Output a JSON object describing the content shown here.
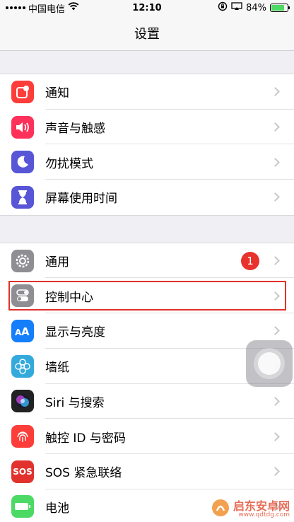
{
  "status_bar": {
    "carrier": "中国电信",
    "time": "12:10",
    "battery_percent": "84%",
    "battery_level": 0.84
  },
  "nav": {
    "title": "设置"
  },
  "groups": [
    {
      "items": [
        {
          "label": "通知",
          "icon": "notifications-icon",
          "color": "#fc3d39"
        },
        {
          "label": "声音与触感",
          "icon": "sound-icon",
          "color": "#fd3159"
        },
        {
          "label": "勿扰模式",
          "icon": "moon-icon",
          "color": "#5856d6"
        },
        {
          "label": "屏幕使用时间",
          "icon": "hourglass-icon",
          "color": "#5856d6"
        }
      ]
    },
    {
      "items": [
        {
          "label": "通用",
          "icon": "gear-icon",
          "color": "#8e8e93",
          "badge": "1"
        },
        {
          "label": "控制中心",
          "icon": "toggles-icon",
          "color": "#8e8e93"
        },
        {
          "label": "显示与亮度",
          "icon": "display-aa-icon",
          "color": "#147efb"
        },
        {
          "label": "墙纸",
          "icon": "wallpaper-flower-icon",
          "color": "#34aadc"
        },
        {
          "label": "Siri 与搜索",
          "icon": "siri-icon",
          "color": "#222"
        },
        {
          "label": "触控 ID 与密码",
          "icon": "fingerprint-icon",
          "color": "#fc3d39"
        },
        {
          "label": "SOS 紧急联络",
          "icon": "sos-icon",
          "color": "#e1322e",
          "icon_text": "SOS"
        },
        {
          "label": "电池",
          "icon": "battery-icon",
          "color": "#4cd964"
        }
      ]
    }
  ],
  "watermark": {
    "title": "启东安卓网",
    "url": "www.qdtdg.com"
  }
}
